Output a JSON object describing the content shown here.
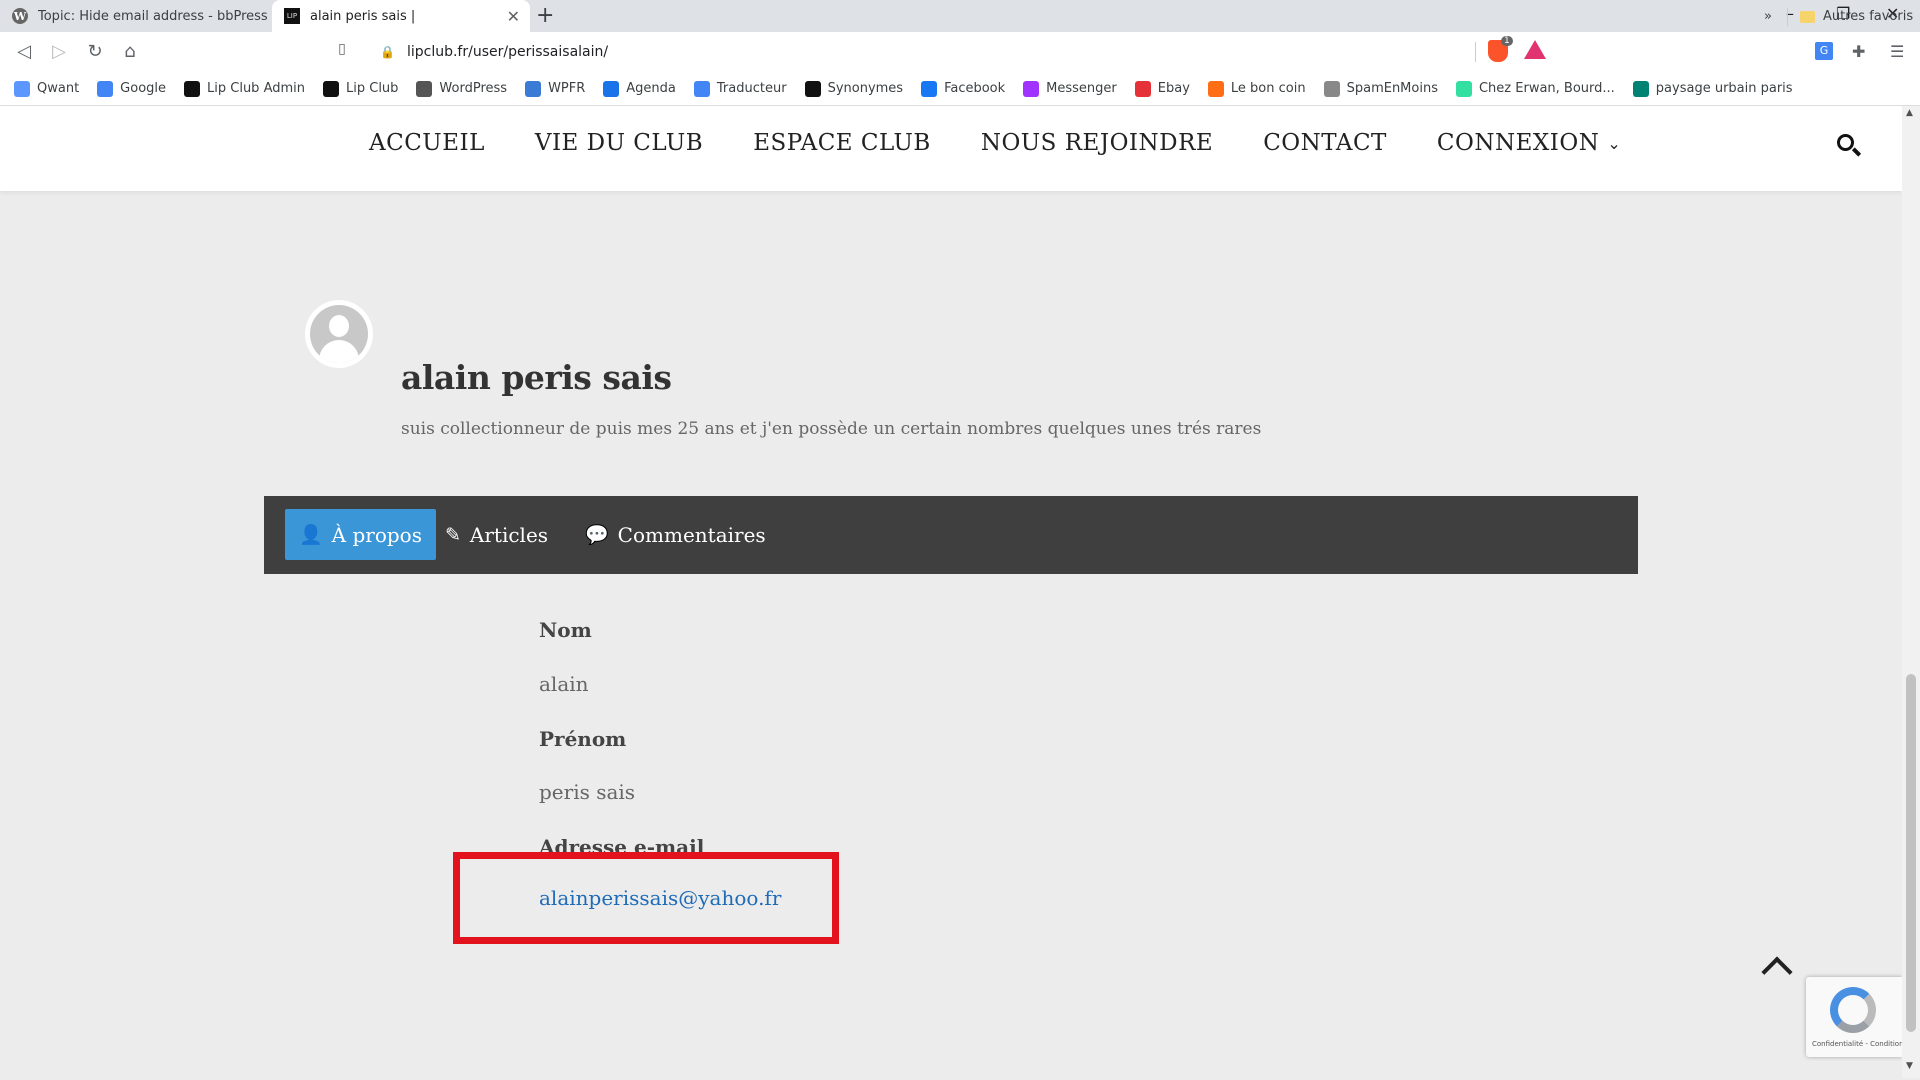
{
  "browser": {
    "tabs": [
      {
        "title": "Topic: Hide email address - bbPress.or",
        "favicon": "wordpress-icon",
        "active": false
      },
      {
        "title": "alain peris sais |",
        "favicon": "lipclub-icon",
        "active": true
      }
    ],
    "new_tab_label": "+",
    "window_controls": {
      "minimize": "–",
      "restore": "❐",
      "close": "✕"
    },
    "nav": {
      "back": "◁",
      "forward": "▷",
      "reload": "↻",
      "home": "⌂",
      "bookmark": "🔖"
    },
    "address": "lipclub.fr/user/perissaisalain/",
    "brave_badge": "1",
    "bookmarks": [
      {
        "label": "Qwant",
        "icon": "qwant-icon",
        "color": "#5c97ff"
      },
      {
        "label": "Google",
        "icon": "google-icon",
        "color": "#4285f4"
      },
      {
        "label": "Lip Club Admin",
        "icon": "lipclub-icon",
        "color": "#111111"
      },
      {
        "label": "Lip Club",
        "icon": "lipclub-icon",
        "color": "#111111"
      },
      {
        "label": "WordPress",
        "icon": "wordpress-icon",
        "color": "#555555"
      },
      {
        "label": "WPFR",
        "icon": "wpfr-icon",
        "color": "#3a7bd5"
      },
      {
        "label": "Agenda",
        "icon": "calendar-icon",
        "color": "#1a73e8"
      },
      {
        "label": "Traducteur",
        "icon": "translate-icon",
        "color": "#4285f4"
      },
      {
        "label": "Synonymes",
        "icon": "synonymes-icon",
        "color": "#111111"
      },
      {
        "label": "Facebook",
        "icon": "facebook-icon",
        "color": "#1877f2"
      },
      {
        "label": "Messenger",
        "icon": "messenger-icon",
        "color": "#a033ff"
      },
      {
        "label": "Ebay",
        "icon": "ebay-icon",
        "color": "#e53238"
      },
      {
        "label": "Le bon coin",
        "icon": "leboncoin-icon",
        "color": "#ff6e14"
      },
      {
        "label": "SpamEnMoins",
        "icon": "spam-icon",
        "color": "#888888"
      },
      {
        "label": "Chez Erwan, Bourd...",
        "icon": "tripadvisor-icon",
        "color": "#34e0a1"
      },
      {
        "label": "paysage urbain paris",
        "icon": "bing-icon",
        "color": "#008373"
      }
    ],
    "bookmarks_more": "»",
    "other_bookmarks": "Autres favoris"
  },
  "site": {
    "menu": [
      "ACCUEIL",
      "VIE DU CLUB",
      "ESPACE CLUB",
      "NOUS REJOINDRE",
      "CONTACT",
      "CONNEXION"
    ],
    "connexion_chevron": "⌄"
  },
  "profile": {
    "display_name": "alain peris sais",
    "bio": "suis collectionneur de puis mes 25 ans et j'en possède un certain nombres quelques unes trés rares",
    "tabs": [
      {
        "label": "À propos",
        "icon": "user-icon",
        "active": true
      },
      {
        "label": "Articles",
        "icon": "pencil-icon",
        "active": false
      },
      {
        "label": "Commentaires",
        "icon": "comment-icon",
        "active": false
      }
    ],
    "fields": {
      "nom_label": "Nom",
      "nom_value": "alain",
      "prenom_label": "Prénom",
      "prenom_value": "peris sais",
      "email_label": "Adresse e-mail",
      "email_value": "alainperissais@yahoo.fr"
    },
    "highlight_color": "#e3131d",
    "accent_color": "#3b96d8"
  },
  "recaptcha": {
    "footer": "Confidentialité - Conditions"
  }
}
